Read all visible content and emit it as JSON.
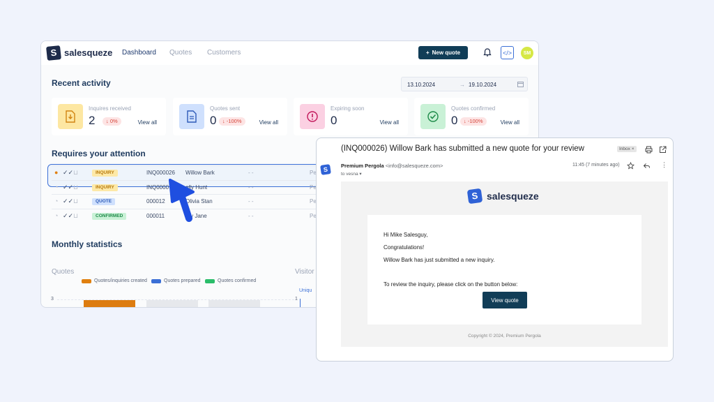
{
  "app": {
    "name": "salesqueze",
    "logo_letter": "S"
  },
  "nav": [
    "Dashboard",
    "Quotes",
    "Customers"
  ],
  "header": {
    "new_quote_label": "New quote",
    "avatar_initials": "SM"
  },
  "recent": {
    "title": "Recent activity",
    "date_from": "13.10.2024",
    "date_to": "19.10.2024",
    "cards": [
      {
        "label": "Inquires received",
        "value": "2",
        "delta": "0%",
        "link": "View all",
        "color": "#fde7a2",
        "icon": "download-doc-icon"
      },
      {
        "label": "Quotes sent",
        "value": "0",
        "delta": "-100%",
        "link": "View all",
        "color": "#cfe0fd",
        "icon": "document-icon"
      },
      {
        "label": "Expiring soon",
        "value": "0",
        "delta": "",
        "link": "View all",
        "color": "#fbd0e2",
        "icon": "alert-circle-icon"
      },
      {
        "label": "Quotes confirmed",
        "value": "0",
        "delta": "-100%",
        "link": "View all",
        "color": "#c9f1d6",
        "icon": "check-circle-icon"
      }
    ]
  },
  "attention": {
    "title": "Requires your attention",
    "rows": [
      {
        "status": "INQUIRY",
        "id": "INQ000026",
        "name": "Willow Bark",
        "dash": "- -",
        "extra": "Pe"
      },
      {
        "status": "INQUIRY",
        "id": "INQ0000",
        "name": "elly Hunt",
        "dash": "- -",
        "extra": "Pe"
      },
      {
        "status": "QUOTE",
        "id": "000012",
        "name": "Olivia Stan",
        "dash": "- -",
        "extra": "Pe"
      },
      {
        "status": "CONFIRMED",
        "id": "000011",
        "name": "ary Jane",
        "dash": "- -",
        "extra": "Pe"
      }
    ]
  },
  "monthly": {
    "title": "Monthly statistics",
    "quotes_label": "Quotes",
    "visitors_label": "Visitor",
    "unique_label": "Uniqu",
    "legend": [
      "Quotes/inquiries created",
      "Quotes prepared",
      "Quotes confirmed"
    ],
    "legend_colors": [
      "#e0800f",
      "#3b6fd6",
      "#2bbd6a"
    ],
    "y_tick": "3",
    "y_tick_right": "1"
  },
  "email": {
    "subject": "(INQ000026) Willow Bark has submitted a new quote for your review",
    "tag": "Inbox ×",
    "sender_name": "Premium Pergola",
    "sender_email": "<info@salesqueze.com>",
    "to": "to vesna ▾",
    "time": "11:45 (7 minutes ago)",
    "brand": "salesqueze",
    "greeting": "Hi Mike Salesguy,",
    "line1": "Congratulations!",
    "line2": "Willow Bark has just submitted a new inquiry.",
    "line3": "To review the inquiry, please click on the button below:",
    "button": "View quote",
    "copyright": "Copyright © 2024, Premium Pergola"
  }
}
